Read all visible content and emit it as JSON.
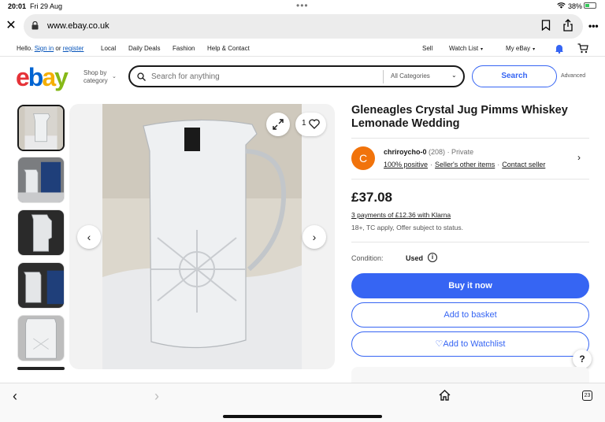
{
  "status_bar": {
    "time": "20:01",
    "date": "Fri 29 Aug",
    "battery": "38%",
    "battery_level": 0.38
  },
  "browser": {
    "url": "www.ebay.co.uk"
  },
  "top_nav": {
    "hello": "Hello.",
    "sign_in": "Sign in",
    "or": "or",
    "register": "register",
    "items": [
      "Local",
      "Daily Deals",
      "Fashion",
      "Help & Contact"
    ],
    "sell": "Sell",
    "watch_list": "Watch List",
    "my_ebay": "My eBay"
  },
  "header": {
    "logo": {
      "e": "e",
      "b": "b",
      "a": "a",
      "y": "y"
    },
    "shop_by_line1": "Shop by",
    "shop_by_line2": "category",
    "search_placeholder": "Search for anything",
    "category_select": "All Categories",
    "search_button": "Search",
    "advanced": "Advanced"
  },
  "gallery": {
    "thumbnail_count": 5,
    "watch_count": "1"
  },
  "listing": {
    "title": "Gleneagles Crystal Jug Pimms Whiskey Lemonade Wedding",
    "seller": {
      "avatar_letter": "C",
      "name": "chriroycho-0",
      "feedback_count": "(208)",
      "type": "· Private",
      "positive": "100% positive",
      "other_items": "Seller's other items",
      "contact": "Contact seller"
    },
    "price": "£37.08",
    "klarna": "3 payments of £12.36 with Klarna",
    "terms": "18+, TC apply, Offer subject to status.",
    "condition_label": "Condition:",
    "condition_value": "Used",
    "buy_now": "Buy it now",
    "add_to_basket": "Add to basket",
    "add_to_watchlist": "Add to Watchlist"
  },
  "bottom_bar": {
    "tabs_count": "23"
  },
  "colors": {
    "primary": "#3665f3",
    "link": "#0654ba",
    "avatar": "#f1730b",
    "logo_e": "#e53238",
    "logo_b": "#0064d2",
    "logo_a": "#f5af02",
    "logo_y": "#86b817"
  },
  "icons": [
    "close-icon",
    "lock-icon",
    "bookmark-icon",
    "share-icon",
    "more-icon",
    "bell-icon",
    "cart-icon",
    "search-icon",
    "chevron-down-icon",
    "expand-icon",
    "heart-icon",
    "chevron-left-icon",
    "chevron-right-icon",
    "info-icon",
    "help-icon",
    "home-icon",
    "tabs-icon"
  ]
}
